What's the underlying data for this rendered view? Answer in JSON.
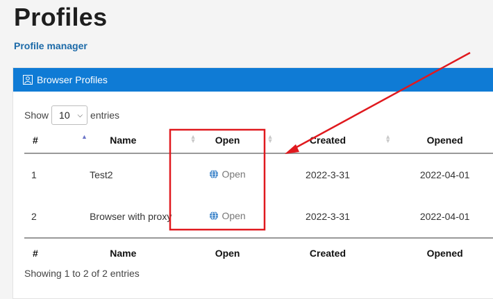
{
  "page": {
    "title": "Profiles",
    "subtitle": "Profile manager"
  },
  "card": {
    "header": "Browser Profiles",
    "header_icon": "profile-icon",
    "header_color": "#0f7bd5"
  },
  "length": {
    "prefix": "Show",
    "value": "10",
    "suffix": "entries"
  },
  "table": {
    "columns": [
      "#",
      "Name",
      "Open",
      "Created",
      "Opened"
    ],
    "rows": [
      {
        "num": "1",
        "name": "Test2",
        "open": "Open",
        "created": "2022-3-31",
        "opened": "2022-04-01"
      },
      {
        "num": "2",
        "name": "Browser with proxy",
        "open": "Open",
        "created": "2022-3-31",
        "opened": "2022-04-01"
      }
    ]
  },
  "info": "Showing 1 to 2 of 2 entries",
  "annotation_color": "#e0191e"
}
